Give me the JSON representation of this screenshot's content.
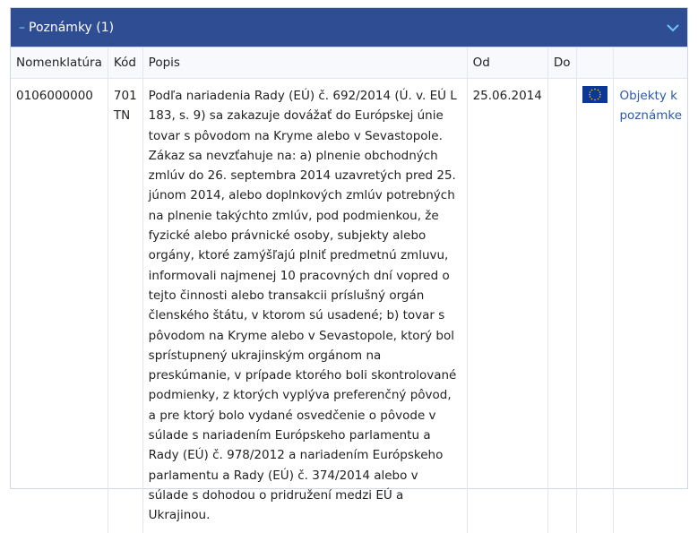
{
  "panel": {
    "collapse_symbol": "–",
    "title": "Poznámky (1)"
  },
  "table": {
    "headers": {
      "nomenclature": "Nomenklatúra",
      "code": "Kód",
      "description": "Popis",
      "from": "Od",
      "to": "Do"
    },
    "rows": [
      {
        "nomenclature": "0106000000",
        "code": "701 TN",
        "description": "Podľa nariadenia Rady (EÚ) č. 692/2014 (Ú. v. EÚ L 183, s. 9) sa zakazuje dovážať do Európskej únie tovar s pôvodom na Kryme alebo v Sevastopole. Zákaz sa nevzťahuje na: a) plnenie obchodných zmlúv do 26. septembra 2014 uzavretých pred 25. júnom 2014, alebo doplnkových zmlúv potrebných na plnenie takýchto zmlúv, pod podmienkou, že fyzické alebo právnické osoby, subjekty alebo orgány, ktoré zamýšľajú plniť predmetnú zmluvu, informovali najmenej 10 pracovných dní vopred o tejto činnosti alebo transakcii príslušný orgán členského štátu, v ktorom sú usadené; b) tovar s pôvodom na Kryme alebo v Sevastopole, ktorý bol sprístupnený ukrajinským orgánom na preskúmanie, v prípade ktorého boli skontrolované podmienky, z ktorých vyplýva preferenčný pôvod, a pre ktorý bolo vydané osvedčenie o pôvode v súlade s nariadením Európskeho parlamentu a Rady (EÚ) č. 978/2012 a nariadením Európskeho parlamentu a Rady (EÚ) č. 374/2014 alebo v súlade s dohodou o pridružení medzi EÚ a Ukrajinou.",
        "from": "25.06.2014",
        "to": "",
        "flag_icon": "eu-flag-icon",
        "link": "Objekty k poznámke"
      }
    ]
  },
  "colors": {
    "header_bg": "#2f4d93",
    "link": "#2a5aa8",
    "flag_blue": "#0b3896",
    "flag_stars": "#ffcc00"
  }
}
